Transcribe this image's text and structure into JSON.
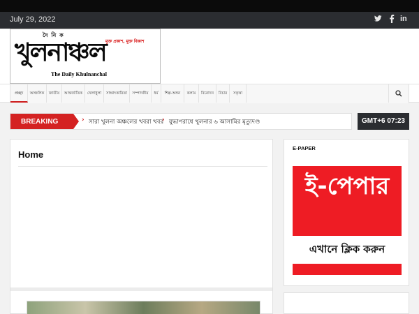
{
  "topbar": {
    "date": "July 29, 2022",
    "social": [
      {
        "icon": "twitter-icon",
        "glyph": "𝕥"
      },
      {
        "icon": "facebook-icon",
        "glyph": "f"
      },
      {
        "icon": "linkedin-icon",
        "glyph": "in"
      }
    ]
  },
  "logo": {
    "prefix": "দৈ নি ক",
    "name": "খুলনাঞ্চল",
    "tagline": "মুক্ত প্রকাশ, মুক্ত বিকাশ",
    "english": "The Daily Khulnanchal"
  },
  "nav": {
    "items": [
      "প্রচ্ছদ",
      "আঞ্চলিক",
      "জাতীয়",
      "আন্তর্জাতিক",
      "খেলাধুলা",
      "সাক্ষাৎকারিতা",
      "সম্পাদকীয়",
      "ধর্ম",
      "শিল্প-অঙ্গন",
      "কলাম",
      "বিনোদন",
      "বিচার",
      "সকৃত্তা"
    ],
    "search_icon": "search-icon"
  },
  "breaking": {
    "label": "BREAKING",
    "items": [
      "সারা খুলনা অঞ্চলের খবরা খবর",
      "যুদ্ধাপরাধে খুলনার ৬ আসামির মৃত্যুদণ্ড"
    ]
  },
  "clock": {
    "text": "GMT+6 07:23"
  },
  "main": {
    "title": "Home"
  },
  "sidebar": {
    "widget_title": "E-PAPER",
    "epaper_big": "ই-পেপার",
    "epaper_small": "এখানে ক্লিক করুন"
  },
  "colors": {
    "accent": "#d42222",
    "dark": "#2b2d31",
    "epaper": "#ee1c24"
  }
}
